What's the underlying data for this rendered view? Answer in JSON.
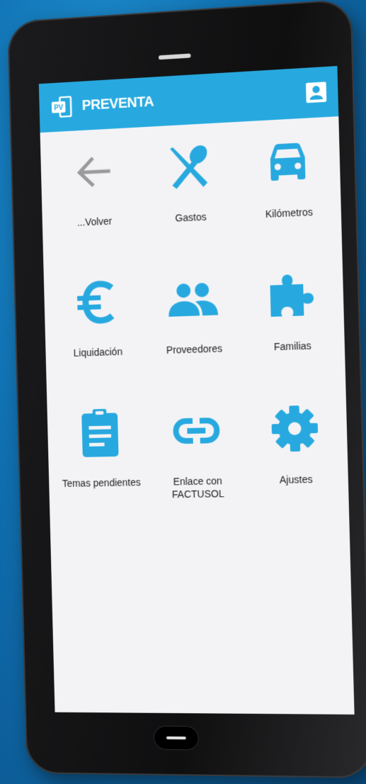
{
  "header": {
    "app_name": "PREVENTA",
    "logo_text": "PV"
  },
  "colors": {
    "accent": "#27a9df",
    "back_arrow": "#9a9a9a",
    "screen_background": "#f3f3f6",
    "label_text": "#222222"
  },
  "menu": {
    "items": [
      {
        "label": "...Volver",
        "icon": "arrow-left-icon"
      },
      {
        "label": "Gastos",
        "icon": "fork-spoon-icon"
      },
      {
        "label": "Kilómetros",
        "icon": "car-icon"
      },
      {
        "label": "Liquidación",
        "icon": "euro-icon"
      },
      {
        "label": "Proveedores",
        "icon": "people-icon"
      },
      {
        "label": "Familias",
        "icon": "puzzle-icon"
      },
      {
        "label": "Temas pendientes",
        "icon": "clipboard-icon"
      },
      {
        "label": "Enlace con FACTUSOL",
        "icon": "link-icon"
      },
      {
        "label": "Ajustes",
        "icon": "gear-icon"
      }
    ]
  }
}
